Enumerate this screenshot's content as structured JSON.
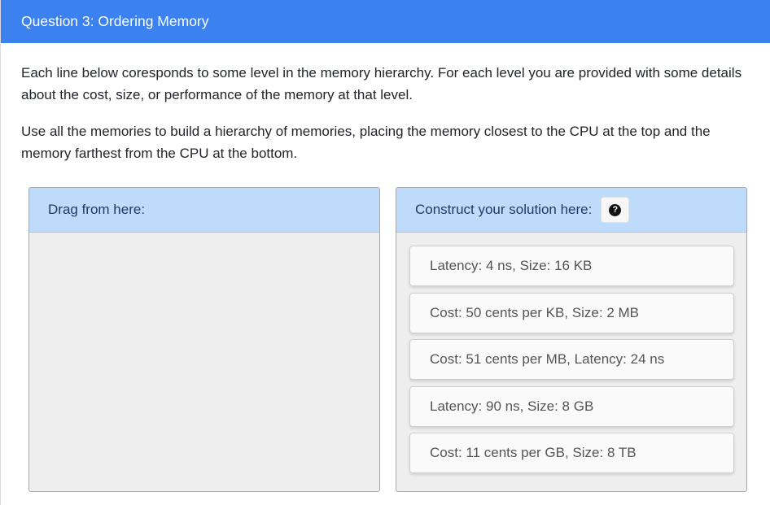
{
  "header": {
    "title": "Question 3: Ordering Memory"
  },
  "instructions": {
    "paragraph1": "Each line below coresponds to some level in the memory hierarchy. For each level you are provided with some details about the cost, size, or performance of the memory at that level.",
    "paragraph2": "Use all the memories to build a hierarchy of memories, placing the memory closest to the CPU at the top and the memory farthest from the CPU at the bottom."
  },
  "source_panel": {
    "label": "Drag from here:",
    "items": []
  },
  "answer_panel": {
    "label": "Construct your solution here:",
    "help_icon": "question-circle-icon",
    "help_glyph": "?",
    "items": [
      {
        "label": "Latency: 4 ns, Size: 16 KB"
      },
      {
        "label": "Cost: 50 cents per KB, Size: 2 MB"
      },
      {
        "label": "Cost: 51 cents per MB, Latency: 24 ns"
      },
      {
        "label": "Latency: 90 ns, Size: 8 GB"
      },
      {
        "label": "Cost: 11 cents per GB, Size: 8 TB"
      }
    ]
  },
  "colors": {
    "header_bg": "#3b82f0",
    "panel_head_bg": "#bfdbfb",
    "panel_bg": "#eeeeee"
  }
}
